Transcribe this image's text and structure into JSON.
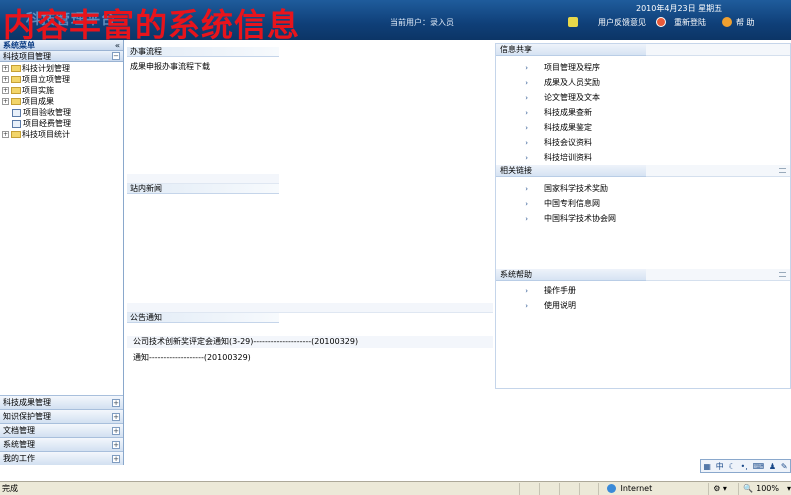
{
  "header": {
    "logo_old": "科技管理平台",
    "overlay_title": "内容丰富的系统信息",
    "date": "2010年4月23日 星期五",
    "current_user": "当前用户：录入员",
    "feedback": "用户反馈意见",
    "relogin": "重新登陆",
    "help": "帮 助"
  },
  "left": {
    "system_menu": "系统菜单",
    "section": "科技项目管理",
    "tree": [
      {
        "label": "科技计划管理",
        "type": "folder"
      },
      {
        "label": "项目立项管理",
        "type": "folder"
      },
      {
        "label": "项目实施",
        "type": "folder"
      },
      {
        "label": "项目成果",
        "type": "folder"
      },
      {
        "label": "项目验收管理",
        "type": "doc"
      },
      {
        "label": "项目经费管理",
        "type": "doc"
      },
      {
        "label": "科技项目统计",
        "type": "folder"
      }
    ],
    "bottom": [
      "科技成果管理",
      "知识保护管理",
      "文档管理",
      "系统管理",
      "我的工作"
    ]
  },
  "mid": {
    "flow_title": "办事流程",
    "flow_item": "成果申报办事流程下载",
    "news_title": "站内新闻",
    "notice_title": "公告通知",
    "notices": [
      "公司技术创新奖评定会通知(3-29)--------------------(20100329)",
      "通知-------------------(20100329)"
    ]
  },
  "right": {
    "share_title": "信息共享",
    "share_items": [
      "项目管理及程序",
      "成果及人员奖励",
      "论文管理及文本",
      "科技成果查新",
      "科技成果鉴定",
      "科技会议资料",
      "科技培训资料"
    ],
    "links_title": "相关链接",
    "links": [
      "国家科学技术奖励",
      "中国专利信息网",
      "中国科学技术协会网"
    ],
    "help_title": "系统帮助",
    "help_items": [
      "操作手册",
      "使用说明"
    ]
  },
  "ime": {
    "cn": "中"
  },
  "status": {
    "left": "完成",
    "zone": "Internet",
    "zoom": "100%"
  },
  "colors": {
    "header": "#0f3f78",
    "title_red": "#e8141c",
    "accent": "#1c4a8a"
  }
}
